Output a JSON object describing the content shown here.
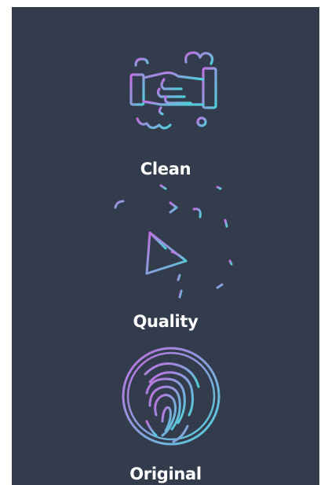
{
  "colors": {
    "background": "#333c4d",
    "gradient_start": "#c26ee0",
    "gradient_end": "#4fd0d9",
    "label_text": "#ffffff"
  },
  "features": [
    {
      "label": "Clean",
      "icon": "hand-washing-icon"
    },
    {
      "label": "Quality",
      "icon": "party-cone-icon"
    },
    {
      "label": "Original",
      "icon": "fingerprint-icon"
    }
  ]
}
